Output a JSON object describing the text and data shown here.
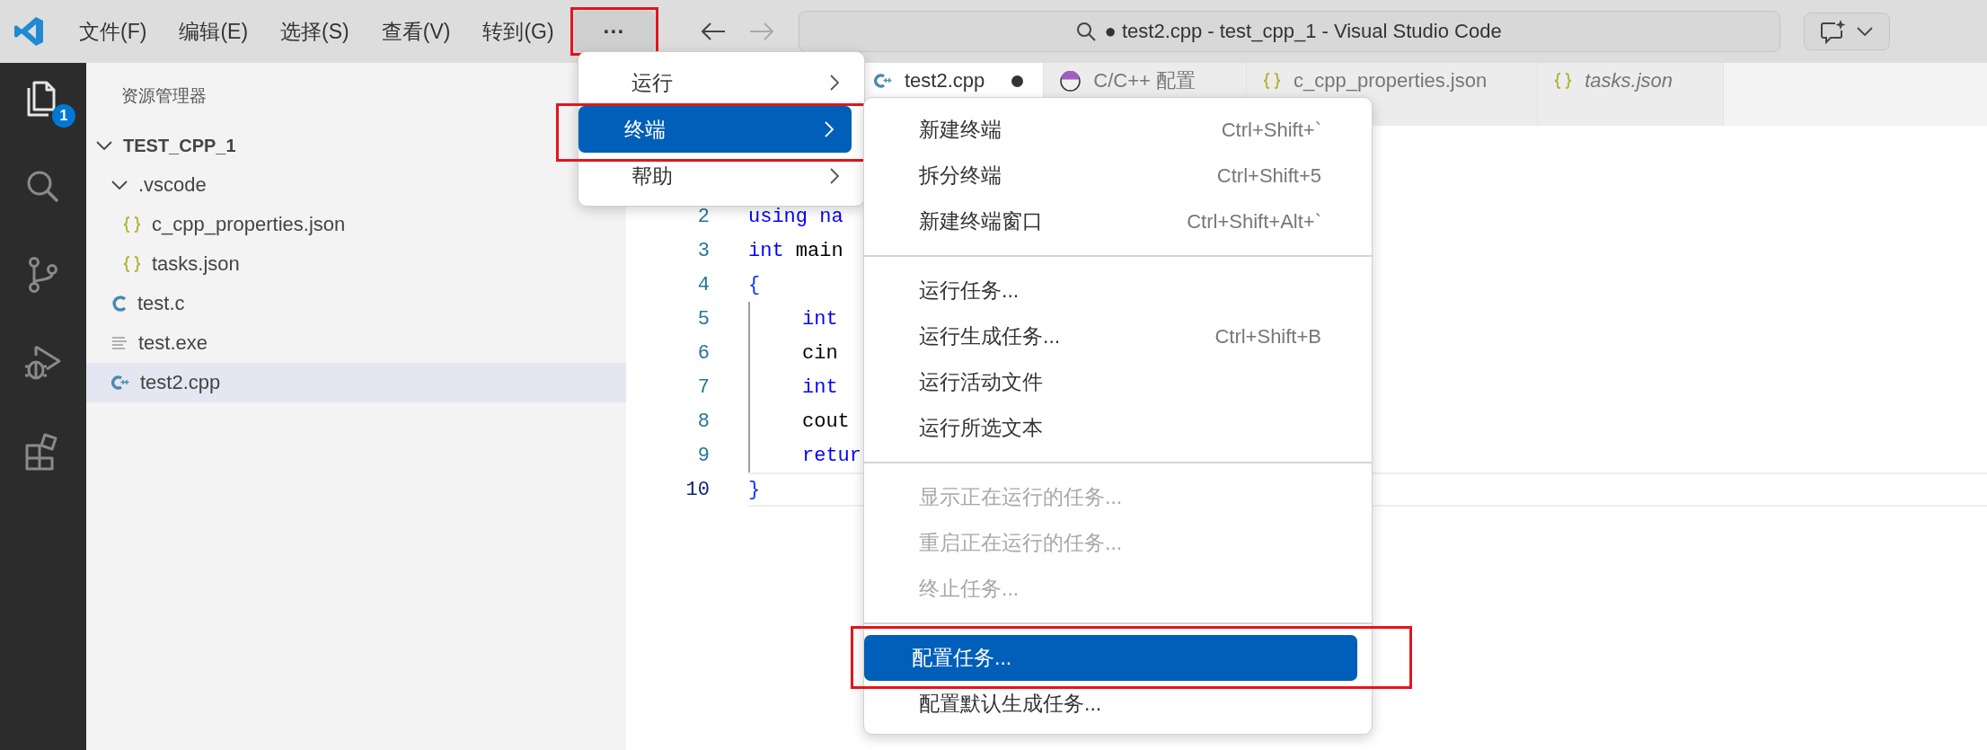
{
  "title_bar": {
    "menus": [
      {
        "label": "文件(F)"
      },
      {
        "label": "编辑(E)"
      },
      {
        "label": "选择(S)"
      },
      {
        "label": "查看(V)"
      },
      {
        "label": "转到(G)"
      }
    ],
    "overflow_button": {
      "label": "···",
      "annotated": true
    },
    "command_center": {
      "text": "● test2.cpp - test_cpp_1 - Visual Studio Code"
    }
  },
  "activity_bar": [
    {
      "kind": "explorer",
      "selected": true,
      "badge": "1"
    },
    {
      "kind": "search",
      "selected": false
    },
    {
      "kind": "source-control",
      "selected": false
    },
    {
      "kind": "run-debug",
      "selected": false
    },
    {
      "kind": "extensions",
      "selected": false
    }
  ],
  "sidebar": {
    "title": "资源管理器",
    "tree": [
      {
        "label": "TEST_CPP_1",
        "kind": "root",
        "expanded": true,
        "selected": false,
        "children": [
          {
            "label": ".vscode",
            "kind": "folder",
            "expanded": true,
            "selected": false,
            "children": [
              {
                "label": "c_cpp_properties.json",
                "kind": "json",
                "selected": false
              },
              {
                "label": "tasks.json",
                "kind": "json",
                "selected": false
              }
            ]
          },
          {
            "label": "test.c",
            "kind": "c",
            "selected": false
          },
          {
            "label": "test.exe",
            "kind": "text",
            "selected": false
          },
          {
            "label": "test2.cpp",
            "kind": "cpp",
            "selected": true
          }
        ]
      }
    ]
  },
  "tabs": [
    {
      "label": "test2.cpp",
      "kind": "cpp",
      "selected": true,
      "modified": true,
      "preview": false
    },
    {
      "label": "C/C++ 配置",
      "kind": "settings",
      "selected": false,
      "modified": false,
      "preview": false
    },
    {
      "label": "c_cpp_properties.json",
      "kind": "json",
      "selected": false,
      "modified": false,
      "preview": false
    },
    {
      "label": "tasks.json",
      "kind": "json",
      "selected": false,
      "modified": false,
      "preview": true
    }
  ],
  "editor": {
    "lines": [
      {
        "number": "2",
        "current": false,
        "indent": false,
        "tokens": [
          {
            "text": "using na",
            "kind": "keyword"
          }
        ]
      },
      {
        "number": "3",
        "current": false,
        "indent": false,
        "tokens": [
          {
            "text": "int",
            "kind": "keyword"
          },
          {
            "text": " main",
            "kind": "plain"
          }
        ]
      },
      {
        "number": "4",
        "current": false,
        "indent": false,
        "tokens": [
          {
            "text": "{",
            "kind": "bracket"
          }
        ]
      },
      {
        "number": "5",
        "current": false,
        "indent": true,
        "tokens": [
          {
            "text": "int",
            "kind": "keyword"
          }
        ]
      },
      {
        "number": "6",
        "current": false,
        "indent": true,
        "tokens": [
          {
            "text": "cin",
            "kind": "plain"
          }
        ]
      },
      {
        "number": "7",
        "current": false,
        "indent": true,
        "tokens": [
          {
            "text": "int",
            "kind": "keyword"
          }
        ]
      },
      {
        "number": "8",
        "current": false,
        "indent": true,
        "tokens": [
          {
            "text": "cout",
            "kind": "plain"
          }
        ]
      },
      {
        "number": "9",
        "current": false,
        "indent": true,
        "tokens": [
          {
            "text": "retur",
            "kind": "keyword"
          }
        ]
      },
      {
        "number": "10",
        "current": true,
        "indent": false,
        "tokens": [
          {
            "text": "}",
            "kind": "bracket"
          }
        ]
      }
    ]
  },
  "overflow_menu": {
    "items": [
      {
        "label": "运行",
        "selected": false,
        "annotated": false
      },
      {
        "label": "终端",
        "selected": true,
        "annotated": true
      },
      {
        "label": "帮助",
        "selected": false,
        "annotated": false
      }
    ]
  },
  "terminal_menu": {
    "groups": [
      [
        {
          "label": "新建终端",
          "shortcut": "Ctrl+Shift+`",
          "disabled": false,
          "selected": false,
          "annotated": false
        },
        {
          "label": "拆分终端",
          "shortcut": "Ctrl+Shift+5",
          "disabled": false,
          "selected": false,
          "annotated": false
        },
        {
          "label": "新建终端窗口",
          "shortcut": "Ctrl+Shift+Alt+`",
          "disabled": false,
          "selected": false,
          "annotated": false
        }
      ],
      [
        {
          "label": "运行任务...",
          "disabled": false,
          "selected": false,
          "annotated": false
        },
        {
          "label": "运行生成任务...",
          "shortcut": "Ctrl+Shift+B",
          "disabled": false,
          "selected": false,
          "annotated": false
        },
        {
          "label": "运行活动文件",
          "disabled": false,
          "selected": false,
          "annotated": false
        },
        {
          "label": "运行所选文本",
          "disabled": false,
          "selected": false,
          "annotated": false
        }
      ],
      [
        {
          "label": "显示正在运行的任务...",
          "disabled": true,
          "selected": false,
          "annotated": false
        },
        {
          "label": "重启正在运行的任务...",
          "disabled": true,
          "selected": false,
          "annotated": false
        },
        {
          "label": "终止任务...",
          "disabled": true,
          "selected": false,
          "annotated": false
        }
      ],
      [
        {
          "label": "配置任务...",
          "disabled": false,
          "selected": true,
          "annotated": true
        },
        {
          "label": "配置默认生成任务...",
          "disabled": false,
          "selected": false,
          "annotated": false
        }
      ]
    ]
  }
}
